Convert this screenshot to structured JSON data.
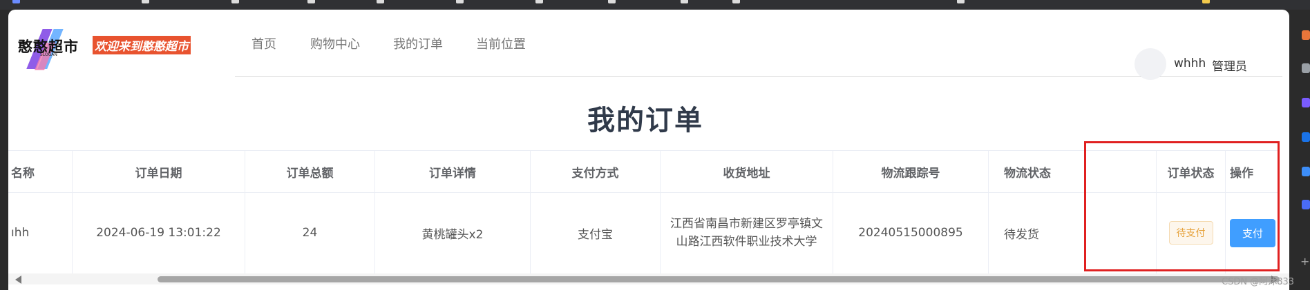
{
  "header": {
    "logo_text": "憨憨超市",
    "logo_sub": "SLOGAN",
    "slogan": "欢迎来到憨憨超市",
    "nav": [
      "首页",
      "购物中心",
      "我的订单",
      "当前位置"
    ],
    "user": {
      "name": "whhh",
      "role": "管理员"
    }
  },
  "page_title": "我的订单",
  "table": {
    "columns": [
      "名称",
      "订单日期",
      "订单总额",
      "订单详情",
      "支付方式",
      "收货地址",
      "物流跟踪号",
      "物流状态",
      "",
      "订单状态",
      "操作"
    ],
    "rows": [
      {
        "name": "ıhh",
        "date": "2024-06-19 13:01:22",
        "total": "24",
        "detail": "黄桃罐头x2",
        "payment": "支付宝",
        "address": "江西省南昌市新建区罗亭镇文山路江西软件职业技术大学",
        "tracking": "20240515000895",
        "logistics_status": "待发货",
        "order_status": "待支付",
        "action": "支付"
      }
    ]
  },
  "watermark": "CSDN @阿沐833",
  "colors": {
    "primary": "#409eff",
    "danger": "#f02828",
    "warning": "#e6a23c",
    "highlight_box": "#e02020",
    "title": "#303a4a"
  }
}
